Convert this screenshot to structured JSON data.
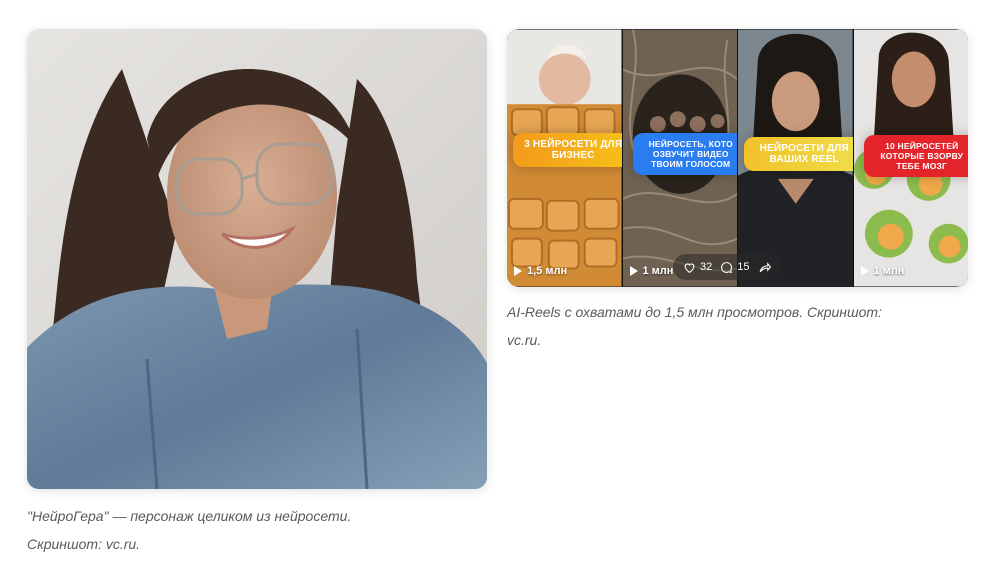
{
  "photo": {
    "caption_line1": "\"НейроГера\" — персонаж целиком из нейросети.",
    "caption_line2": "Скриншот: vc.ru."
  },
  "reels": {
    "tiles": [
      {
        "title": "3 НЕЙРОСЕТИ ДЛЯ БИЗНЕС",
        "views": "1,5 млн"
      },
      {
        "title": "НЕЙРОСЕТЬ, КОТО ОЗВУЧИТ ВИДЕО ТВОИМ ГОЛОСОМ",
        "views": "1 млн"
      },
      {
        "title": "НЕЙРОСЕТИ ДЛЯ ВАШИХ REEL",
        "views": ""
      },
      {
        "title": "10 НЕЙРОСЕТЕЙ КОТОРЫЕ ВЗОРВУ ТЕБЕ МОЗГ",
        "views": "1 млн"
      }
    ],
    "likes": "32",
    "comments": "15",
    "caption_line1": "AI-Reels с охватами до 1,5 млн просмотров. Скриншот:",
    "caption_line2": "vc.ru."
  },
  "icons": {
    "play": "play-icon",
    "heart": "heart-icon",
    "comment": "comment-icon",
    "share": "share-icon"
  },
  "colors": {
    "caption_text": "#5a5a5a",
    "label_orange": "#f39a1a",
    "label_blue": "#2a7df0",
    "label_yellow": "#f2c12a",
    "label_red": "#e3252b"
  }
}
